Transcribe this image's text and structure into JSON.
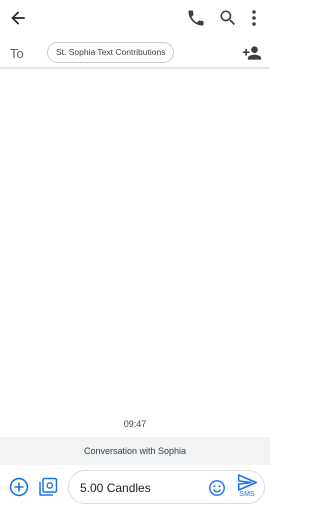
{
  "top_bar": {
    "back_icon": "arrow-back-icon",
    "actions": [
      "phone-icon",
      "search-icon",
      "more-vert-icon"
    ]
  },
  "recipient": {
    "to_label": "To",
    "chip_label": "St. Sophia Text Contributions",
    "add_icon": "person-add-icon"
  },
  "thread": {
    "timestamp": "09:47",
    "conversation_label": "Conversation with Sophia"
  },
  "compose": {
    "message_text": "5.00 Candles",
    "send_label": "SMS",
    "accent_color": "#1a73e8"
  }
}
